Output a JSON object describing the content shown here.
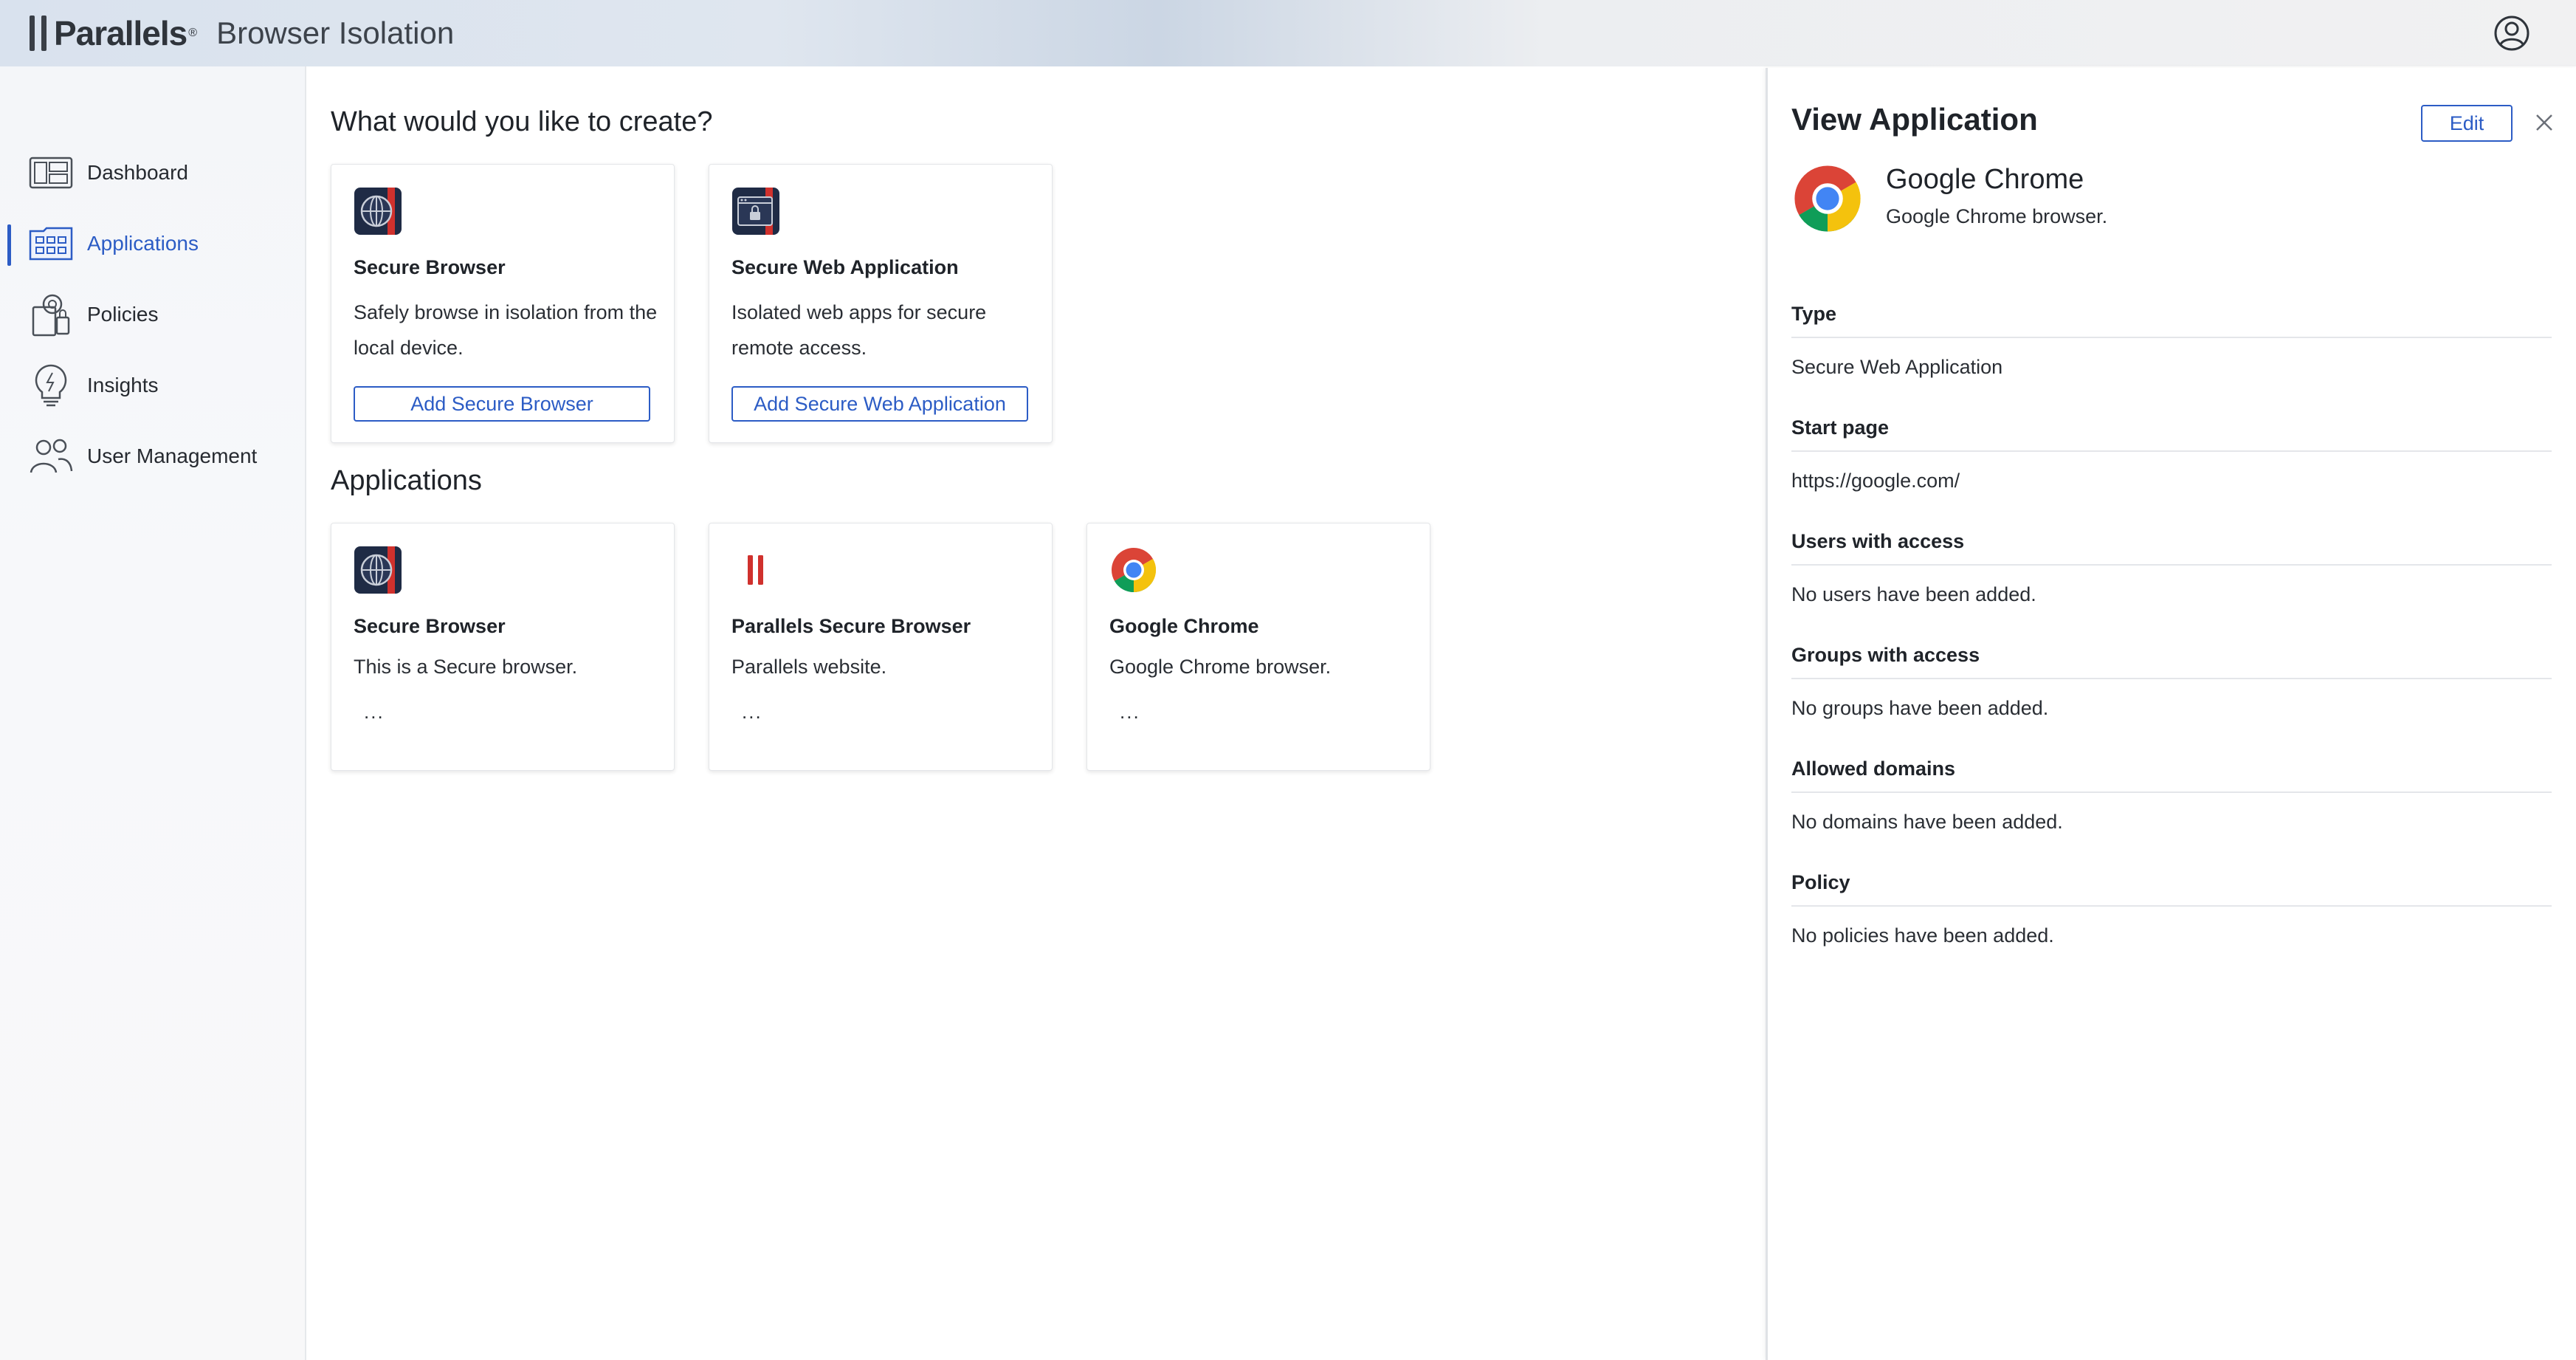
{
  "header": {
    "brand": "Parallels",
    "brand_mark": "®",
    "product": "Browser Isolation",
    "account_icon": "user-circle-icon"
  },
  "sidebar": {
    "items": [
      {
        "label": "Dashboard",
        "icon": "dashboard-icon",
        "active": false
      },
      {
        "label": "Applications",
        "icon": "applications-icon",
        "active": true
      },
      {
        "label": "Policies",
        "icon": "policies-icon",
        "active": false
      },
      {
        "label": "Insights",
        "icon": "insights-icon",
        "active": false
      },
      {
        "label": "User Management",
        "icon": "users-icon",
        "active": false
      }
    ]
  },
  "main": {
    "create_title": "What would you like to create?",
    "create_cards": [
      {
        "icon": "secure-browser-icon",
        "title": "Secure Browser",
        "description": "Safely browse in isolation from the local device.",
        "button": "Add Secure Browser"
      },
      {
        "icon": "secure-web-app-icon",
        "title": "Secure Web Application",
        "description": "Isolated web apps for secure remote access.",
        "button": "Add Secure Web Application"
      }
    ],
    "applications_title": "Applications",
    "applications": [
      {
        "icon": "secure-browser-icon",
        "title": "Secure Browser",
        "description": "This is a Secure browser.",
        "more": "..."
      },
      {
        "icon": "parallels-icon",
        "title": "Parallels Secure Browser",
        "description": "Parallels website.",
        "more": "..."
      },
      {
        "icon": "chrome-icon",
        "title": "Google Chrome",
        "description": "Google Chrome browser.",
        "more": "..."
      }
    ]
  },
  "panel": {
    "title": "View Application",
    "edit_label": "Edit",
    "close_icon": "close-icon",
    "app_name": "Google Chrome",
    "app_description": "Google Chrome browser.",
    "details": [
      {
        "label": "Type",
        "value": "Secure Web Application"
      },
      {
        "label": "Start page",
        "value": "https://google.com/"
      },
      {
        "label": "Users with access",
        "value": "No users have been added."
      },
      {
        "label": "Groups with access",
        "value": "No groups have been added."
      },
      {
        "label": "Allowed domains",
        "value": "No domains have been added."
      },
      {
        "label": "Policy",
        "value": "No policies have been added."
      }
    ]
  },
  "colors": {
    "accent": "#2c5cc5",
    "brand_red": "#d0312d",
    "brand_dark": "#1f2b45"
  }
}
